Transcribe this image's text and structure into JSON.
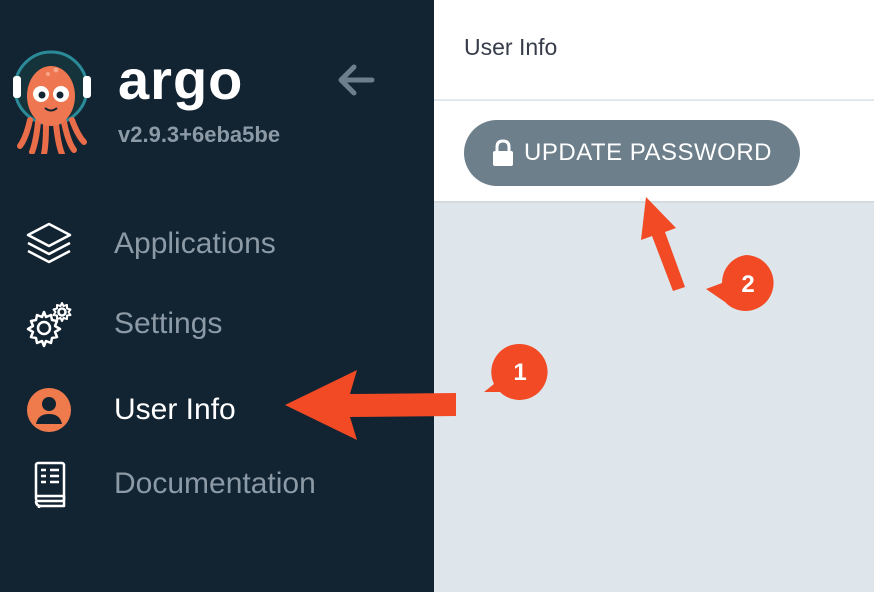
{
  "sidebar": {
    "brand": "argo",
    "version": "v2.9.3+6eba5be",
    "items": [
      {
        "label": "Applications",
        "icon": "layers-icon"
      },
      {
        "label": "Settings",
        "icon": "gears-icon"
      },
      {
        "label": "User Info",
        "icon": "user-circle-icon",
        "active": true
      },
      {
        "label": "Documentation",
        "icon": "book-icon"
      }
    ]
  },
  "header": {
    "title": "User Info"
  },
  "toolbar": {
    "update_password_label": "UPDATE PASSWORD"
  },
  "annotations": {
    "callout_1": "1",
    "callout_2": "2"
  },
  "colors": {
    "sidebar_bg": "#122332",
    "nav_text": "#8c9aa5",
    "nav_text_active": "#ffffff",
    "button_bg": "#6d7f8b",
    "content_bg": "#dee6eb",
    "accent_orange": "#f14a25",
    "user_icon": "#ef7b4d"
  }
}
